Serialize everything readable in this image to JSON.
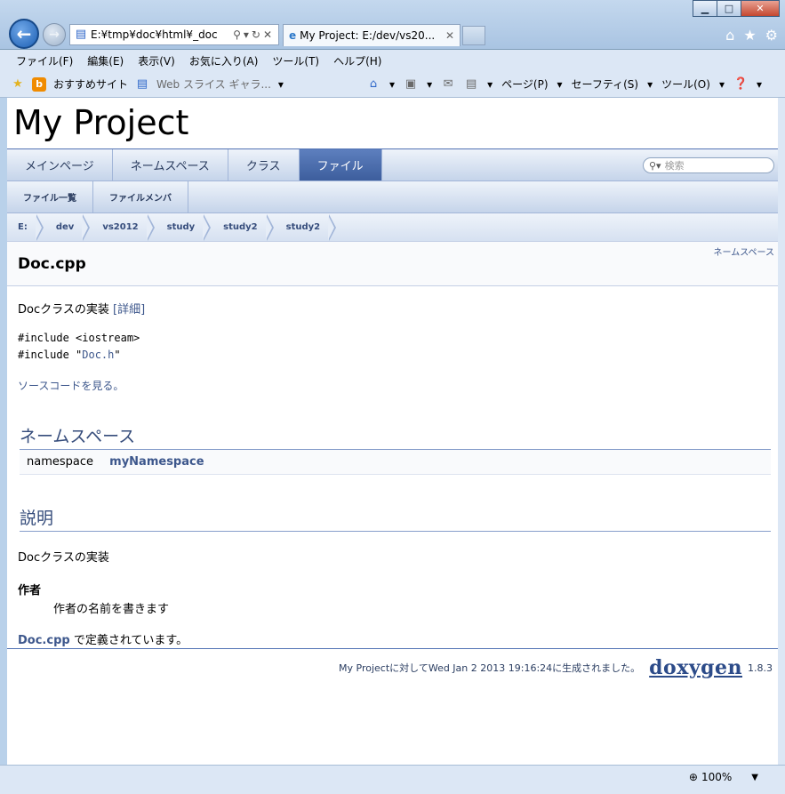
{
  "browser": {
    "address": "E:¥tmp¥doc¥html¥_doc",
    "tab_title": "My Project: E:/dev/vs20...",
    "menu": [
      "ファイル(F)",
      "編集(E)",
      "表示(V)",
      "お気に入り(A)",
      "ツール(T)",
      "ヘルプ(H)"
    ],
    "favorites": [
      "おすすめサイト",
      "Web スライス ギャラ..."
    ],
    "commands": [
      "ページ(P)",
      "セーフティ(S)",
      "ツール(O)"
    ],
    "zoom": "100%"
  },
  "project": {
    "title": "My Project"
  },
  "nav": {
    "tabs": [
      "メインページ",
      "ネームスペース",
      "クラス",
      "ファイル"
    ],
    "active": "ファイル",
    "search_placeholder": "検索",
    "subtabs": [
      "ファイル一覧",
      "ファイルメンバ"
    ],
    "breadcrumbs": [
      "E:",
      "dev",
      "vs2012",
      "study",
      "study2",
      "study2"
    ]
  },
  "header": {
    "title": "Doc.cpp",
    "link": "ネームスペース"
  },
  "content": {
    "brief": "Docクラスの実装",
    "brief_more": "[詳細]",
    "include1": "#include <iostream>",
    "include2_pre": "#include \"",
    "include2_link": "Doc.h",
    "include2_post": "\"",
    "source_link": "ソースコードを見る。",
    "ns_heading": "ネームスペース",
    "ns_keyword": "namespace",
    "ns_name": "myNamespace",
    "desc_heading": "説明",
    "desc_text": "Docクラスの実装",
    "author_label": "作者",
    "author_value": "作者の名前を書きます",
    "defined_link": "Doc.cpp",
    "defined_text": " で定義されています。"
  },
  "footer": {
    "text": "My Projectに対してWed Jan 2 2013 19:16:24に生成されました。",
    "logo": "doxygen",
    "version": "1.8.3"
  }
}
